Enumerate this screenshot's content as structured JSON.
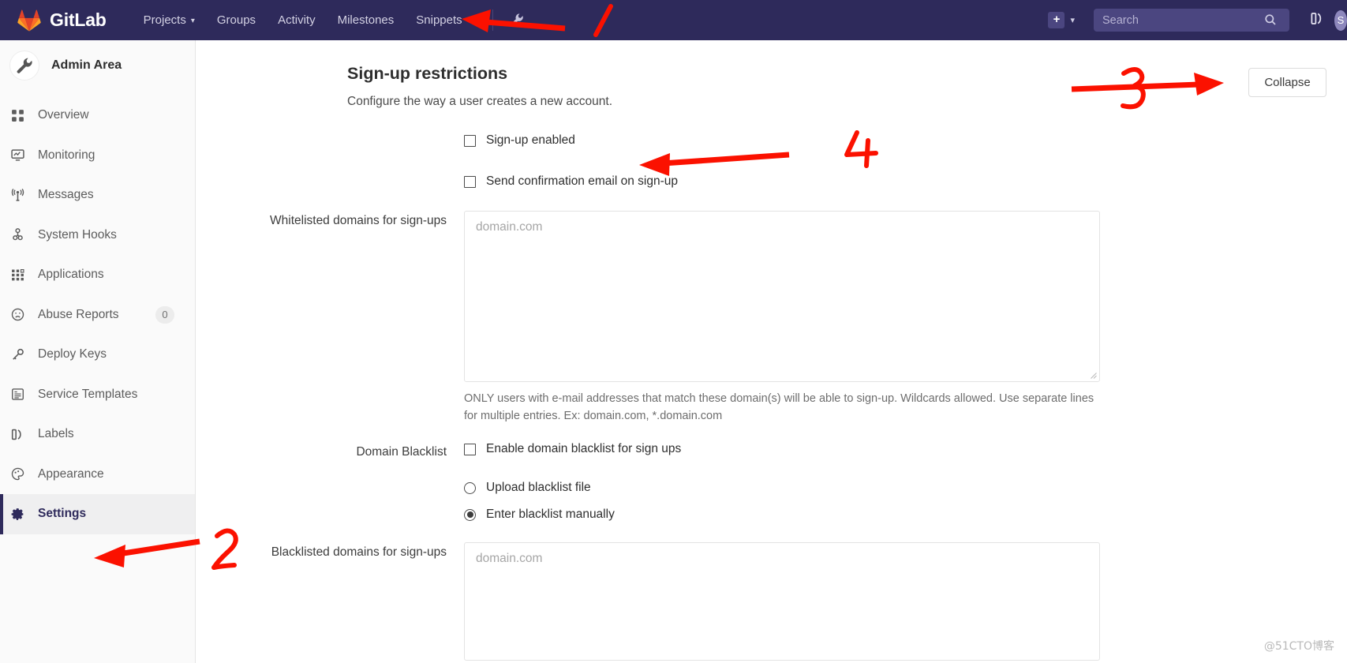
{
  "navbar": {
    "brand": "GitLab",
    "logo_icon": "gitlab-tanuki-icon",
    "links": [
      {
        "label": "Projects",
        "has_caret": true
      },
      {
        "label": "Groups",
        "has_caret": false
      },
      {
        "label": "Activity",
        "has_caret": false
      },
      {
        "label": "Milestones",
        "has_caret": false
      },
      {
        "label": "Snippets",
        "has_caret": false
      }
    ],
    "admin_icon": "wrench-icon",
    "new_icon": "plus-square-icon",
    "new_caret_icon": "chevron-down-icon",
    "search": {
      "placeholder": "Search",
      "icon": "search-icon"
    },
    "labels_icon": "labels-icon",
    "avatar_initial": "S"
  },
  "sidebar": {
    "title": "Admin Area",
    "avatar_icon": "wrench-icon",
    "items": [
      {
        "label": "Overview",
        "icon": "grid-squares-icon",
        "badge": null,
        "active": false
      },
      {
        "label": "Monitoring",
        "icon": "monitor-chart-icon",
        "badge": null,
        "active": false
      },
      {
        "label": "Messages",
        "icon": "broadcast-icon",
        "badge": null,
        "active": false
      },
      {
        "label": "System Hooks",
        "icon": "hook-icon",
        "badge": null,
        "active": false
      },
      {
        "label": "Applications",
        "icon": "app-grid-icon",
        "badge": null,
        "active": false
      },
      {
        "label": "Abuse Reports",
        "icon": "sad-face-icon",
        "badge": "0",
        "active": false
      },
      {
        "label": "Deploy Keys",
        "icon": "key-icon",
        "badge": null,
        "active": false
      },
      {
        "label": "Service Templates",
        "icon": "template-icon",
        "badge": null,
        "active": false
      },
      {
        "label": "Labels",
        "icon": "labels-icon",
        "badge": null,
        "active": false
      },
      {
        "label": "Appearance",
        "icon": "palette-icon",
        "badge": null,
        "active": false
      },
      {
        "label": "Settings",
        "icon": "gear-icon",
        "badge": null,
        "active": true
      }
    ]
  },
  "panel": {
    "title": "Sign-up restrictions",
    "subtitle": "Configure the way a user creates a new account.",
    "collapse_label": "Collapse"
  },
  "form": {
    "signup_enabled": {
      "label": "Sign-up enabled",
      "checked": false
    },
    "confirmation_email": {
      "label": "Send confirmation email on sign-up",
      "checked": false
    },
    "whitelist": {
      "label": "Whitelisted domains for sign-ups",
      "placeholder": "domain.com",
      "value": "",
      "help": "ONLY users with e-mail addresses that match these domain(s) will be able to sign-up. Wildcards allowed. Use separate lines for multiple entries. Ex: domain.com, *.domain.com"
    },
    "blacklist_section": {
      "label": "Domain Blacklist",
      "enable": {
        "label": "Enable domain blacklist for sign ups",
        "checked": false
      },
      "options": [
        {
          "label": "Upload blacklist file",
          "selected": false
        },
        {
          "label": "Enter blacklist manually",
          "selected": true
        }
      ]
    },
    "blacklisted": {
      "label": "Blacklisted domains for sign-ups",
      "placeholder": "domain.com",
      "value": ""
    }
  },
  "annotations": {
    "color": "#fb1100",
    "marks": [
      {
        "number": "1",
        "points_to": "admin-wrench-icon"
      },
      {
        "number": "2",
        "points_to": "sidebar-item-settings"
      },
      {
        "number": "3",
        "points_to": "collapse-button"
      },
      {
        "number": "4",
        "points_to": "signup-enabled-checkbox"
      }
    ]
  },
  "watermark": "@51CTO博客"
}
